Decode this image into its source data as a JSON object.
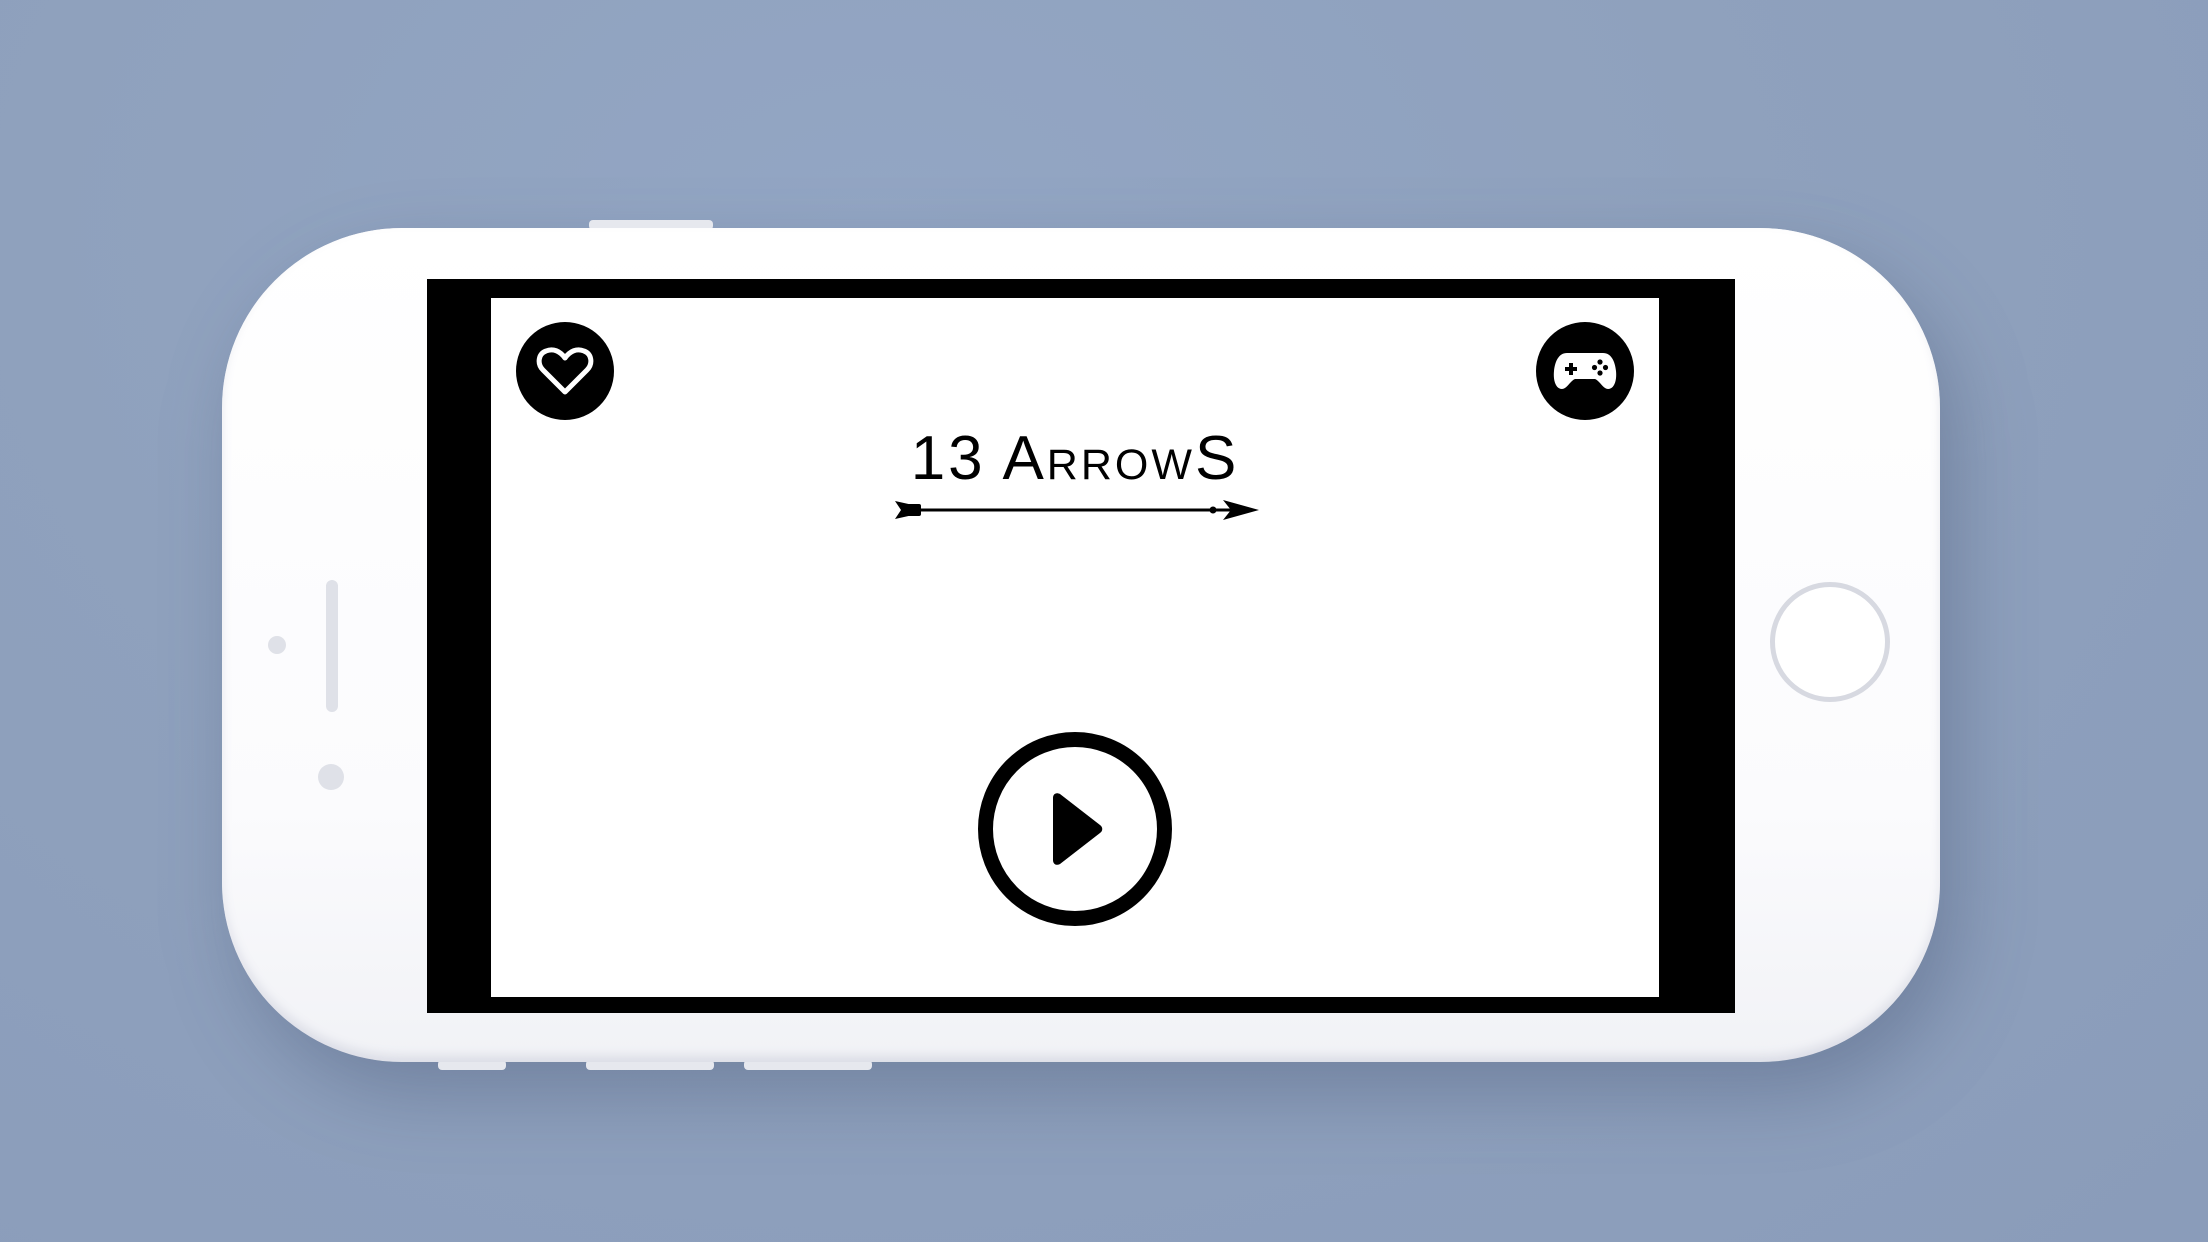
{
  "game": {
    "title": "13 ArrowS"
  },
  "buttons": {
    "favorite_icon": "heart-icon",
    "more_games_icon": "gamepad-icon",
    "play_icon": "play-icon"
  },
  "colors": {
    "background": "#8fa1bd",
    "device": "#ffffff",
    "screen_bezel": "#000000",
    "screen": "#ffffff",
    "ink": "#000000"
  }
}
